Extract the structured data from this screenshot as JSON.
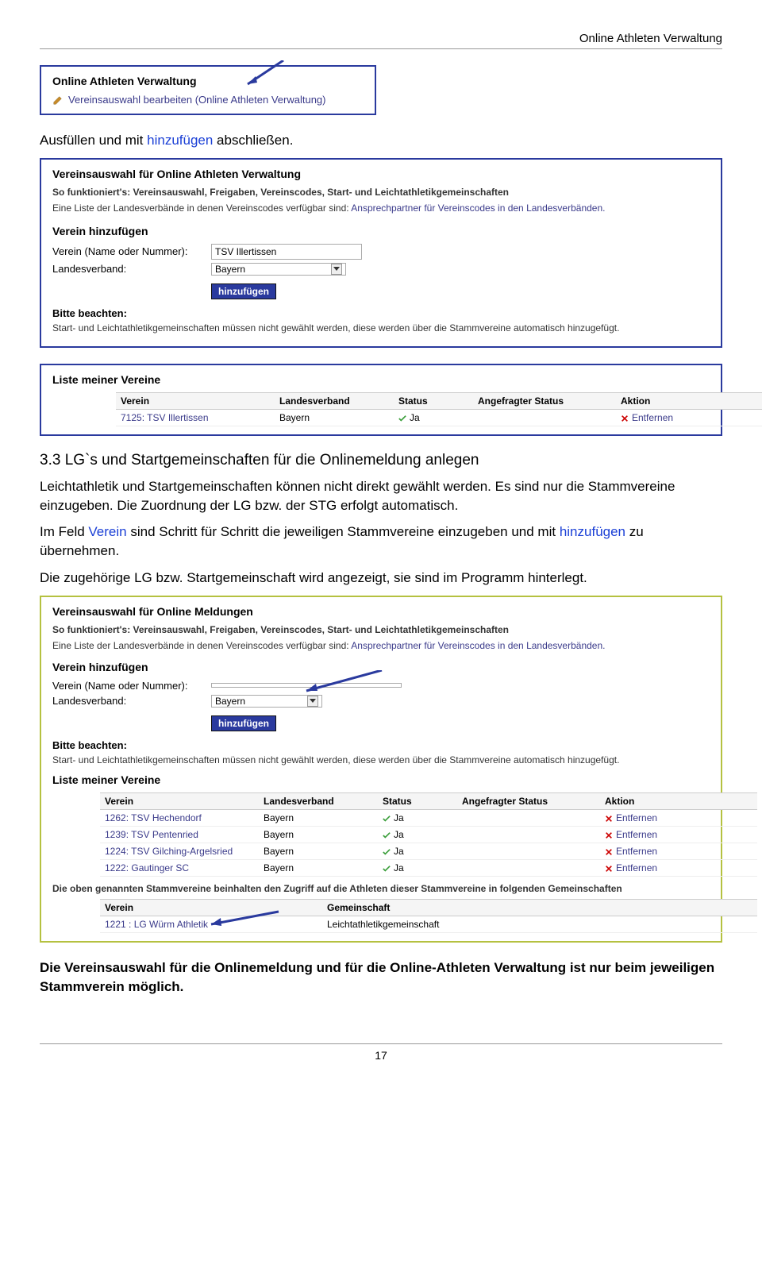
{
  "header": {
    "title": "Online Athleten Verwaltung"
  },
  "box1": {
    "title": "Online Athleten Verwaltung",
    "subtitle": "Vereinsauswahl bearbeiten (Online Athleten Verwaltung)"
  },
  "intro1_prefix": "Ausfüllen und mit ",
  "intro1_blue": "hinzufügen",
  "intro1_suffix": " abschließen.",
  "box2": {
    "title": "Vereinsauswahl für Online Athleten Verwaltung",
    "info_bold": "So funktioniert's: Vereinsauswahl, Freigaben, Vereinscodes, Start- und Leichtathletikgemeinschaften",
    "info_text_prefix": "Eine Liste der Landesverbände in denen Vereinscodes verfügbar sind: ",
    "info_text_link": "Ansprechpartner für Vereinscodes in den Landesverbänden.",
    "section": "Verein hinzufügen",
    "label_verein": "Verein (Name oder Nummer):",
    "input_verein": "TSV Illertissen",
    "label_land": "Landesverband:",
    "select_land": "Bayern",
    "btn": "hinzufügen",
    "note_title": "Bitte beachten:",
    "note_text": "Start- und Leichtathletikgemeinschaften müssen nicht gewählt werden, diese werden über die Stammvereine automatisch hinzugefügt."
  },
  "box3": {
    "title": "Liste meiner Vereine",
    "headers": {
      "verein": "Verein",
      "land": "Landesverband",
      "status": "Status",
      "ang": "Angefragter Status",
      "aktion": "Aktion"
    },
    "rows": [
      {
        "verein": "7125: TSV Illertissen",
        "land": "Bayern",
        "status": "Ja",
        "aktion": "Entfernen"
      }
    ]
  },
  "sec33": {
    "heading": "3.3 LG`s und Startgemeinschaften für die Onlinemeldung anlegen",
    "p1": "Leichtathletik und Startgemeinschaften können nicht direkt gewählt werden. Es sind nur die Stammvereine einzugeben. Die Zuordnung der LG bzw. der STG erfolgt automatisch.",
    "p2_prefix": "Im Feld ",
    "p2_b1": "Verein",
    "p2_mid": " sind Schritt für Schritt die jeweiligen Stammvereine einzugeben und mit ",
    "p2_b2": "hinzufügen",
    "p2_suffix": " zu übernehmen.",
    "p3": "Die zugehörige LG bzw. Startgemeinschaft wird angezeigt, sie sind im Programm hinterlegt."
  },
  "box4": {
    "title": "Vereinsauswahl für Online Meldungen",
    "info_bold": "So funktioniert's: Vereinsauswahl, Freigaben, Vereinscodes, Start- und Leichtathletikgemeinschaften",
    "info_text_prefix": "Eine Liste der Landesverbände in denen Vereinscodes verfügbar sind: ",
    "info_text_link": "Ansprechpartner für Vereinscodes in den Landesverbänden.",
    "section": "Verein hinzufügen",
    "label_verein": "Verein (Name oder Nummer):",
    "input_verein": "",
    "label_land": "Landesverband:",
    "select_land": "Bayern",
    "btn": "hinzufügen",
    "note_title": "Bitte beachten:",
    "note_text": "Start- und Leichtathletikgemeinschaften müssen nicht gewählt werden, diese werden über die Stammvereine automatisch hinzugefügt.",
    "list_title": "Liste meiner Vereine",
    "headers": {
      "verein": "Verein",
      "land": "Landesverband",
      "status": "Status",
      "ang": "Angefragter Status",
      "aktion": "Aktion"
    },
    "rows": [
      {
        "verein": "1262: TSV Hechendorf",
        "land": "Bayern",
        "status": "Ja",
        "aktion": "Entfernen"
      },
      {
        "verein": "1239: TSV Pentenried",
        "land": "Bayern",
        "status": "Ja",
        "aktion": "Entfernen"
      },
      {
        "verein": "1224: TSV Gilching-Argelsried",
        "land": "Bayern",
        "status": "Ja",
        "aktion": "Entfernen"
      },
      {
        "verein": "1222: Gautinger SC",
        "land": "Bayern",
        "status": "Ja",
        "aktion": "Entfernen"
      }
    ],
    "gemein_text": "Die oben genannten Stammvereine beinhalten den Zugriff auf die Athleten dieser Stammvereine in folgenden Gemeinschaften",
    "gemein_headers": {
      "verein": "Verein",
      "gem": "Gemeinschaft"
    },
    "gemein_rows": [
      {
        "verein": "1221 : LG Würm Athletik",
        "gem": "Leichtathletikgemeinschaft"
      }
    ]
  },
  "conclusion": "Die Vereinsauswahl für die Onlinemeldung und für die Online-Athleten Verwaltung ist nur beim jeweiligen Stammverein möglich.",
  "footer": {
    "page": "17"
  }
}
